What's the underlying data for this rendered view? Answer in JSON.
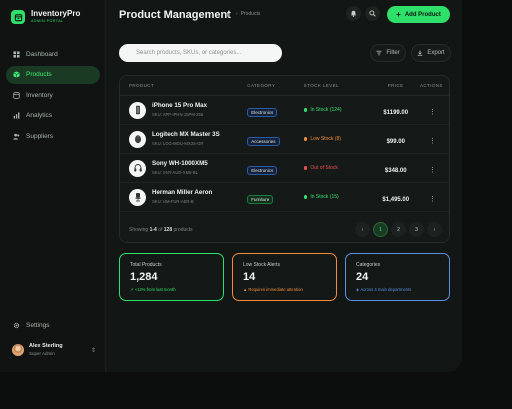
{
  "brand": {
    "name": "InventoryPro",
    "subtitle": "ADMIN PORTAL"
  },
  "nav": [
    {
      "label": "Dashboard",
      "icon": "dashboard-icon",
      "active": false
    },
    {
      "label": "Products",
      "icon": "box-icon",
      "active": true
    },
    {
      "label": "Inventory",
      "icon": "database-icon",
      "active": false
    },
    {
      "label": "Analytics",
      "icon": "chart-icon",
      "active": false
    },
    {
      "label": "Suppliers",
      "icon": "users-icon",
      "active": false
    }
  ],
  "settings_label": "Settings",
  "user": {
    "name": "Alex Sterling",
    "role": "Super Admin"
  },
  "header": {
    "title": "Product Management",
    "breadcrumb": "Products",
    "add_label": "Add Product"
  },
  "search": {
    "placeholder": "Search products, SKUs, or categories..."
  },
  "toolbar": {
    "filter_label": "Filter",
    "export_label": "Export"
  },
  "table": {
    "columns": [
      "PRODUCT",
      "CATEGORY",
      "STOCK LEVEL",
      "PRICE",
      "ACTIONS"
    ],
    "rows": [
      {
        "name": "iPhone 15 Pro Max",
        "sku": "SKU: APP-IPHN-15PM-256",
        "category": "Electronics",
        "stock": "In Stock (124)",
        "stock_color": "#35e06f",
        "price": "$1199.00",
        "thumb": "phone-icon"
      },
      {
        "name": "Logitech MX Master 3S",
        "sku": "SKU: LOG-MOU-MX3S-GR",
        "category": "Accessories",
        "stock": "Low Stock (8)",
        "stock_color": "#f08c3a",
        "price": "$99.00",
        "thumb": "mouse-icon"
      },
      {
        "name": "Sony WH-1000XM5",
        "sku": "SKU: SNY-AUD-XM5-BL",
        "category": "Electronics",
        "stock": "Out of Stock",
        "stock_color": "#f05252",
        "price": "$348.00",
        "thumb": "headphones-icon"
      },
      {
        "name": "Herman Miller Aeron",
        "sku": "SKU: HM-FUR-AER-B",
        "category": "Furniture",
        "stock": "In Stock (15)",
        "stock_color": "#35e06f",
        "price": "$1,495.00",
        "thumb": "chair-icon"
      }
    ]
  },
  "footer": {
    "prefix": "Showing",
    "range": "1-4",
    "of": "of",
    "total": "128",
    "suffix": "products"
  },
  "pagination": {
    "pages": [
      "1",
      "2",
      "3"
    ],
    "active": "1"
  },
  "cards": [
    {
      "label": "Total Products",
      "value": "1,284",
      "note": "+12% from last month",
      "color": "#2ee06a"
    },
    {
      "label": "Low Stock Alerts",
      "value": "14",
      "note": "Requires immediate attention",
      "color": "#f08c3a"
    },
    {
      "label": "Categories",
      "value": "24",
      "note": "Across 4 main departments",
      "color": "#5b8fe0"
    }
  ]
}
